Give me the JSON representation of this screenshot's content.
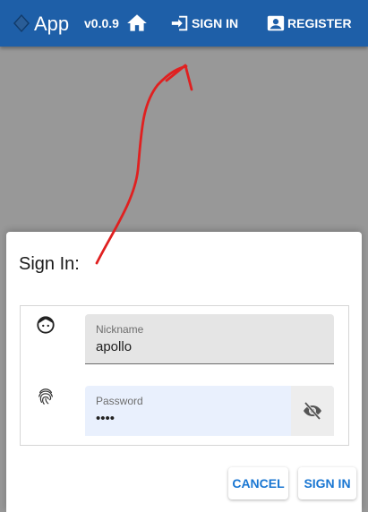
{
  "appbar": {
    "brand_icon": "diamond-icon",
    "title": "App",
    "version": "v0.0.9",
    "home_icon": "home-icon",
    "signin_icon": "login-arrow-icon",
    "signin_label": "SIGN IN",
    "register_icon": "account-box-icon",
    "register_label": "REGISTER",
    "color": "#1e5fa8"
  },
  "dialog": {
    "title": "Sign In:",
    "nickname": {
      "icon": "face-icon",
      "label": "Nickname",
      "value": "apollo"
    },
    "password": {
      "icon": "fingerprint-icon",
      "label": "Password",
      "value": "••••",
      "toggle_icon": "eye-off-icon"
    },
    "cancel_label": "CANCEL",
    "submit_label": "SIGN IN",
    "accent": "#1976d2"
  },
  "annotation": {
    "type": "red-arrow",
    "color": "#e02020"
  }
}
